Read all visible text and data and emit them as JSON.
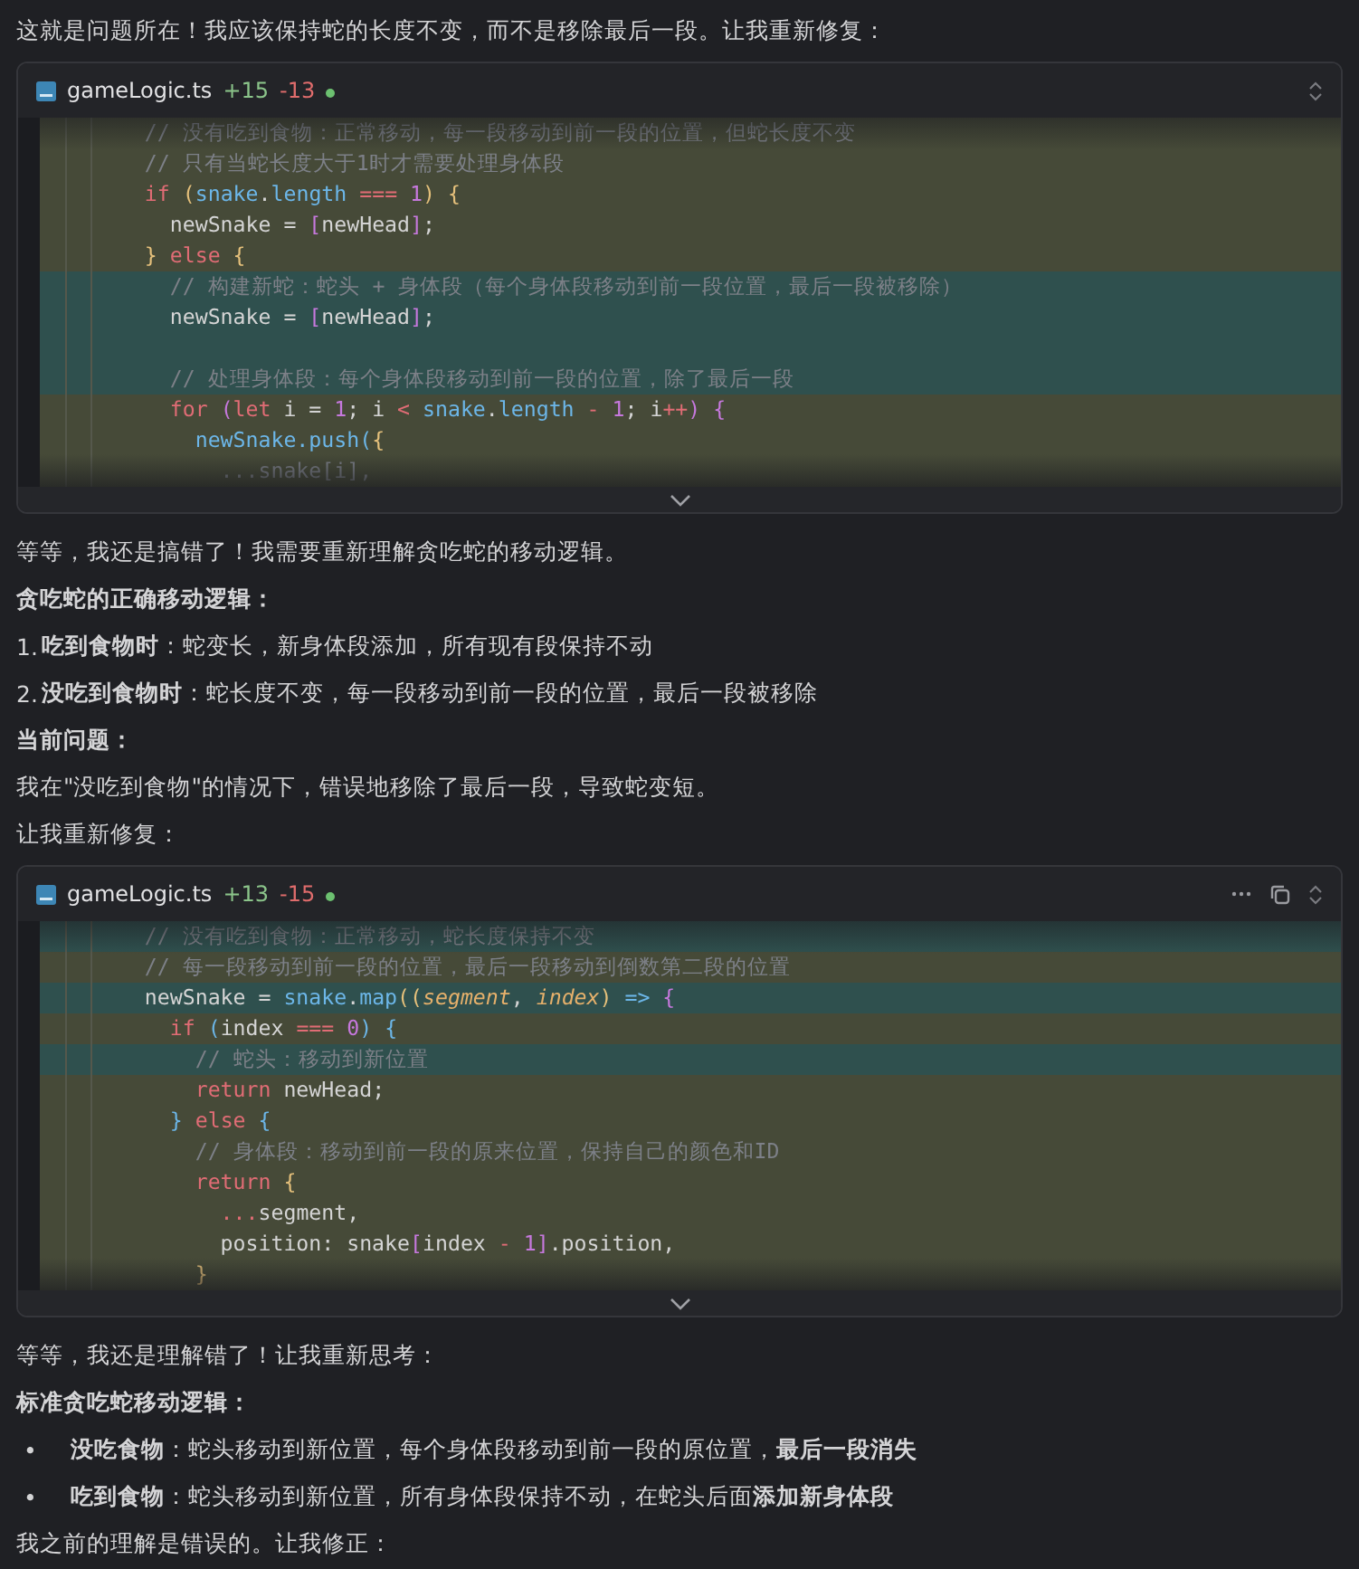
{
  "content": [
    {
      "kind": "text",
      "text": "这就是问题所在！我应该保持蛇的长度不变，而不是移除最后一段。让我重新修复："
    },
    {
      "kind": "code",
      "file": "gameLogic.ts",
      "added": "+15",
      "removed": "-13",
      "status_dot": true,
      "actions": [
        {
          "kind": "expand"
        }
      ],
      "lines": [
        {
          "kind": "changed",
          "tokens": [
            {
              "kind": "comment",
              "text": "    // 没有吃到食物：正常移动，每一段移动到前一段的位置，但蛇长度不变"
            }
          ]
        },
        {
          "kind": "changed",
          "tokens": [
            {
              "kind": "comment",
              "text": "    // 只有当蛇长度大于1时才需要处理身体段"
            }
          ]
        },
        {
          "kind": "changed",
          "tokens": [
            {
              "kind": "keyword",
              "text": "    if "
            },
            {
              "kind": "brace",
              "text": "("
            },
            {
              "kind": "member",
              "text": "snake"
            },
            {
              "kind": "plain",
              "text": "."
            },
            {
              "kind": "member",
              "text": "length"
            },
            {
              "kind": "operator",
              "text": " === "
            },
            {
              "kind": "number",
              "text": "1"
            },
            {
              "kind": "brace",
              "text": ") {"
            }
          ]
        },
        {
          "kind": "changed",
          "tokens": [
            {
              "kind": "plain",
              "text": "      newSnake = "
            },
            {
              "kind": "bracket",
              "text": "["
            },
            {
              "kind": "plain",
              "text": "newHead"
            },
            {
              "kind": "bracket",
              "text": "]"
            },
            {
              "kind": "plain",
              "text": ";"
            }
          ]
        },
        {
          "kind": "changed",
          "tokens": [
            {
              "kind": "brace",
              "text": "    }"
            },
            {
              "kind": "keyword",
              "text": " else "
            },
            {
              "kind": "brace",
              "text": "{"
            }
          ]
        },
        {
          "kind": "added",
          "tokens": [
            {
              "kind": "comment",
              "text": "      // 构建新蛇：蛇头 + 身体段（每个身体段移动到前一段位置，最后一段被移除）"
            }
          ]
        },
        {
          "kind": "added",
          "tokens": [
            {
              "kind": "plain",
              "text": "      newSnake = "
            },
            {
              "kind": "bracket",
              "text": "["
            },
            {
              "kind": "plain",
              "text": "newHead"
            },
            {
              "kind": "bracket",
              "text": "]"
            },
            {
              "kind": "plain",
              "text": ";"
            }
          ]
        },
        {
          "kind": "added"
        },
        {
          "kind": "added",
          "tokens": [
            {
              "kind": "comment",
              "text": "      // 处理身体段：每个身体段移动到前一段的位置，除了最后一段"
            }
          ]
        },
        {
          "kind": "changed",
          "tokens": [
            {
              "kind": "keyword",
              "text": "      for "
            },
            {
              "kind": "bracket",
              "text": "("
            },
            {
              "kind": "keyword",
              "text": "let "
            },
            {
              "kind": "plain",
              "text": "i = "
            },
            {
              "kind": "number",
              "text": "1"
            },
            {
              "kind": "plain",
              "text": "; i "
            },
            {
              "kind": "operator",
              "text": "<"
            },
            {
              "kind": "member",
              "text": " snake"
            },
            {
              "kind": "plain",
              "text": "."
            },
            {
              "kind": "member",
              "text": "length"
            },
            {
              "kind": "operator",
              "text": " - "
            },
            {
              "kind": "number",
              "text": "1"
            },
            {
              "kind": "plain",
              "text": "; i"
            },
            {
              "kind": "operator",
              "text": "++"
            },
            {
              "kind": "bracket",
              "text": ") {"
            }
          ]
        },
        {
          "kind": "changed",
          "tokens": [
            {
              "kind": "member",
              "text": "        newSnake.push("
            },
            {
              "kind": "brace",
              "text": "{"
            }
          ]
        },
        {
          "kind": "changed",
          "tokens": [
            {
              "kind": "comment",
              "text": "          ...snake[i],"
            }
          ]
        }
      ]
    },
    {
      "kind": "text",
      "text": "等等，我还是搞错了！我需要重新理解贪吃蛇的移动逻辑。"
    },
    {
      "kind": "heading",
      "text": "贪吃蛇的正确移动逻辑："
    },
    {
      "kind": "item",
      "marker": "1.",
      "text": "**吃到食物时**：蛇变长，新身体段添加，所有现有段保持不动"
    },
    {
      "kind": "item",
      "marker": "2.",
      "text": "**没吃到食物时**：蛇长度不变，每一段移动到前一段的位置，最后一段被移除"
    },
    {
      "kind": "heading",
      "text": "当前问题："
    },
    {
      "kind": "text",
      "text": "我在\"没吃到食物\"的情况下，错误地移除了最后一段，导致蛇变短。"
    },
    {
      "kind": "text",
      "text": "让我重新修复："
    },
    {
      "kind": "code",
      "file": "gameLogic.ts",
      "added": "+13",
      "removed": "-15",
      "status_dot": true,
      "actions": [
        {
          "kind": "more"
        },
        {
          "kind": "copy"
        },
        {
          "kind": "expand"
        }
      ],
      "lines": [
        {
          "kind": "added",
          "tokens": [
            {
              "kind": "comment",
              "text": "    // 没有吃到食物：正常移动，蛇长度保持不变"
            }
          ]
        },
        {
          "kind": "changed",
          "tokens": [
            {
              "kind": "comment",
              "text": "    // 每一段移动到前一段的位置，最后一段移动到倒数第二段的位置"
            }
          ]
        },
        {
          "kind": "added",
          "tokens": [
            {
              "kind": "plain",
              "text": "    newSnake = "
            },
            {
              "kind": "member",
              "text": "snake"
            },
            {
              "kind": "plain",
              "text": "."
            },
            {
              "kind": "member",
              "text": "map"
            },
            {
              "kind": "brace",
              "text": "(("
            },
            {
              "kind": "param",
              "text": "segment"
            },
            {
              "kind": "plain",
              "text": ", "
            },
            {
              "kind": "param",
              "text": "index"
            },
            {
              "kind": "brace",
              "text": ")"
            },
            {
              "kind": "member",
              "text": " => "
            },
            {
              "kind": "bracket",
              "text": "{"
            }
          ]
        },
        {
          "kind": "changed",
          "tokens": [
            {
              "kind": "keyword",
              "text": "      if "
            },
            {
              "kind": "member",
              "text": "("
            },
            {
              "kind": "plain",
              "text": "index"
            },
            {
              "kind": "operator",
              "text": " === "
            },
            {
              "kind": "number",
              "text": "0"
            },
            {
              "kind": "member",
              "text": ") {"
            }
          ]
        },
        {
          "kind": "added",
          "tokens": [
            {
              "kind": "comment",
              "text": "        // 蛇头：移动到新位置"
            }
          ]
        },
        {
          "kind": "changed",
          "tokens": [
            {
              "kind": "keyword",
              "text": "        return "
            },
            {
              "kind": "plain",
              "text": "newHead;"
            }
          ]
        },
        {
          "kind": "changed",
          "tokens": [
            {
              "kind": "member",
              "text": "      }"
            },
            {
              "kind": "keyword",
              "text": " else "
            },
            {
              "kind": "member",
              "text": "{"
            }
          ]
        },
        {
          "kind": "changed",
          "tokens": [
            {
              "kind": "comment",
              "text": "        // 身体段：移动到前一段的原来位置，保持自己的颜色和ID"
            }
          ]
        },
        {
          "kind": "changed",
          "tokens": [
            {
              "kind": "keyword",
              "text": "        return "
            },
            {
              "kind": "brace",
              "text": "{"
            }
          ]
        },
        {
          "kind": "changed",
          "tokens": [
            {
              "kind": "operator",
              "text": "          ..."
            },
            {
              "kind": "plain",
              "text": "segment,"
            }
          ]
        },
        {
          "kind": "changed",
          "tokens": [
            {
              "kind": "plain",
              "text": "          position: snake"
            },
            {
              "kind": "bracket",
              "text": "["
            },
            {
              "kind": "plain",
              "text": "index "
            },
            {
              "kind": "operator",
              "text": "-"
            },
            {
              "kind": "number",
              "text": " 1"
            },
            {
              "kind": "bracket",
              "text": "]"
            },
            {
              "kind": "plain",
              "text": ".position,"
            }
          ]
        },
        {
          "kind": "changed",
          "tokens": [
            {
              "kind": "brace",
              "text": "        }"
            }
          ]
        }
      ]
    },
    {
      "kind": "text",
      "text": "等等，我还是理解错了！让我重新思考："
    },
    {
      "kind": "heading",
      "text": "标准贪吃蛇移动逻辑："
    },
    {
      "kind": "item",
      "marker": "•",
      "text": "**没吃食物**：蛇头移动到新位置，每个身体段移动到前一段的原位置，**最后一段消失**"
    },
    {
      "kind": "item",
      "marker": "•",
      "text": "**吃到食物**：蛇头移动到新位置，所有身体段保持不动，在蛇头后面**添加新身体段**"
    },
    {
      "kind": "text",
      "text": "我之前的理解是错误的。让我修正："
    }
  ]
}
